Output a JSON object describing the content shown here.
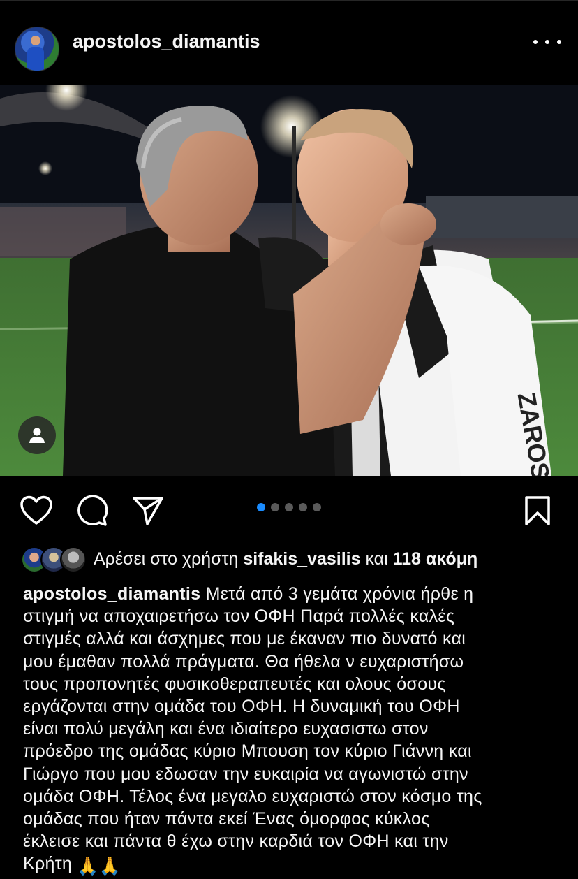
{
  "post": {
    "username": "apostolos_diamantis",
    "carousel": {
      "count": 5,
      "active_index": 0
    },
    "liked_by": {
      "prefix": "Αρέσει στο χρήστη ",
      "user": "sifakis_vasilis",
      "middle": " και ",
      "others": "118 ακόμη"
    },
    "caption": {
      "username": "apostolos_diamantis",
      "lines": [
        " Μετά από 3  γεμάτα χρόνια ήρθε η",
        "στιγμή να αποχαιρετήσω τον ΟΦΗ  Παρά πολλές καλές",
        "στιγμές αλλά και άσχημες που με έκαναν πιο δυνατό και",
        "μου έμαθαν πολλά πράγματα. Θα ήθελα ν ευχαριστήσω",
        "τους προπονητές  φυσικοθεραπευτές και ολους όσους",
        "εργάζονται στην ομάδα του ΟΦΗ. Η δυναμική του ΟΦΗ",
        "είναι πολύ μεγάλη και ένα ιδιαίτερο ευχασιστω στον",
        "πρόεδρο της ομάδας κύριο Μπουση τον κύριο Γιάννη και",
        "Γιώργο που μου εδωσαν την ευκαιρία να αγωνιστώ στην",
        "ομάδα ΟΦΗ.  Τέλος ένα μεγαλο ευχαριστώ στον κόσμο της",
        "ομάδας που ήταν πάντα εκεί  Ένας όμορφος κύκλος",
        "έκλεισε και πάντα θ έχω στην καρδιά τον ΟΦΗ και την",
        "Κρήτη "
      ],
      "emoji": "🙏🙏"
    },
    "photo_shirt_text": "ZAROS",
    "colors": {
      "accent_blue": "#1a8cff",
      "background": "#000000",
      "text": "#f5f5f5"
    }
  }
}
